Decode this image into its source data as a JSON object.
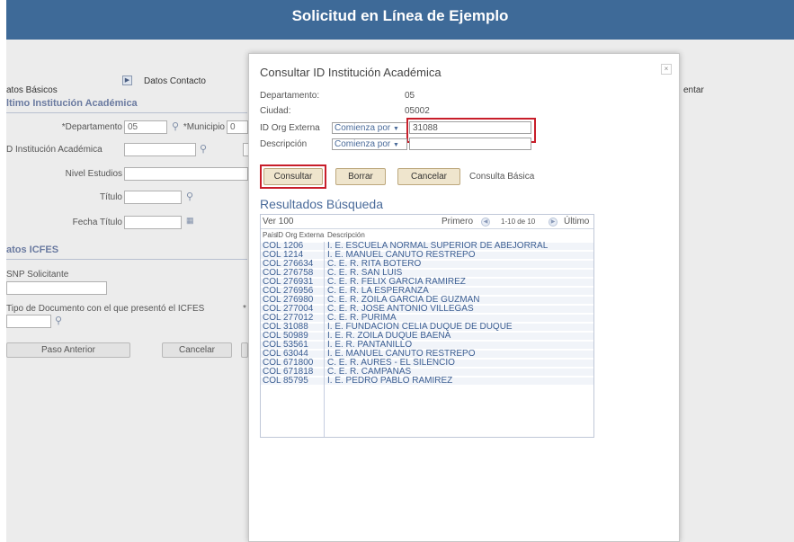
{
  "header": {
    "title": "Solicitud en Línea de Ejemplo"
  },
  "background": {
    "tabs": {
      "tab1": "atos Básicos",
      "tab2": "Datos Contacto",
      "tab_right": "entar"
    },
    "section_academic": "ltimo Institución Académica",
    "fields": {
      "departamento_label": "*Departamento",
      "departamento_value": "05",
      "municipio_label": "*Municipio",
      "municipio_value": "0",
      "institucion_label": "D Institución Académica",
      "nivel_label": "Nivel Estudios",
      "titulo_label": "Título",
      "fecha_label": "Fecha Título"
    },
    "section_icfes": "atos ICFES",
    "snp_label": "SNP Solicitante",
    "tipo_doc_label": "Tipo de Documento con el que presentó el ICFES",
    "tipo_doc_asterisk": "*",
    "btn_prev": "Paso Anterior",
    "btn_cancel": "Cancelar"
  },
  "modal": {
    "title": "Consultar ID Institución Académica",
    "close": "×",
    "departamento_label": "Departamento:",
    "departamento_value": "05",
    "ciudad_label": "Ciudad:",
    "ciudad_value": "05002",
    "idorg_label": "ID Org Externa",
    "idorg_operator": "Comienza por",
    "idorg_value": "31088",
    "desc_label": "Descripción",
    "desc_operator": "Comienza por",
    "desc_value": "",
    "btn_consultar": "Consultar",
    "btn_borrar": "Borrar",
    "btn_cancelar": "Cancelar",
    "link_basic": "Consulta Básica",
    "results_title": "Resultados Búsqueda",
    "grid": {
      "view_all": "Ver 100",
      "first": "Primero",
      "range": "1-10 de 10",
      "last": "Último",
      "headers": [
        "País",
        "ID Org Externa",
        "Descripción"
      ],
      "rows": [
        {
          "pais": "COL",
          "id": "1206",
          "desc": "I. E. ESCUELA NORMAL SUPERIOR DE ABEJORRAL"
        },
        {
          "pais": "COL",
          "id": "1214",
          "desc": "I. E. MANUEL CANUTO RESTREPO"
        },
        {
          "pais": "COL",
          "id": "276634",
          "desc": "C. E. R. RITA BOTERO"
        },
        {
          "pais": "COL",
          "id": "276758",
          "desc": "C. E. R. SAN LUIS"
        },
        {
          "pais": "COL",
          "id": "276931",
          "desc": "C. E. R. FELIX GARCIA RAMIREZ"
        },
        {
          "pais": "COL",
          "id": "276956",
          "desc": "C. E. R. LA ESPERANZA"
        },
        {
          "pais": "COL",
          "id": "276980",
          "desc": "C. E. R. ZOILA GARCIA DE GUZMAN"
        },
        {
          "pais": "COL",
          "id": "277004",
          "desc": "C. E. R. JOSE ANTONIO VILLEGAS"
        },
        {
          "pais": "COL",
          "id": "277012",
          "desc": "C. E. R. PURIMA"
        },
        {
          "pais": "COL",
          "id": "31088",
          "desc": "I. E. FUNDACION CELIA DUQUE DE DUQUE"
        },
        {
          "pais": "COL",
          "id": "50989",
          "desc": "I. E. R. ZOILA DUQUE BAENA"
        },
        {
          "pais": "COL",
          "id": "53561",
          "desc": "I. E. R. PANTANILLO"
        },
        {
          "pais": "COL",
          "id": "63044",
          "desc": "I. E. MANUEL CANUTO RESTREPO"
        },
        {
          "pais": "COL",
          "id": "671800",
          "desc": "C. E. R. AURES - EL SILENCIO"
        },
        {
          "pais": "COL",
          "id": "671818",
          "desc": "C. E. R. CAMPANAS"
        },
        {
          "pais": "COL",
          "id": "85795",
          "desc": "I. E. PEDRO PABLO RAMIREZ"
        }
      ]
    }
  },
  "colors": {
    "header": "#3e6a98",
    "highlight": "#c81e2a",
    "link": "#3d5f93"
  }
}
